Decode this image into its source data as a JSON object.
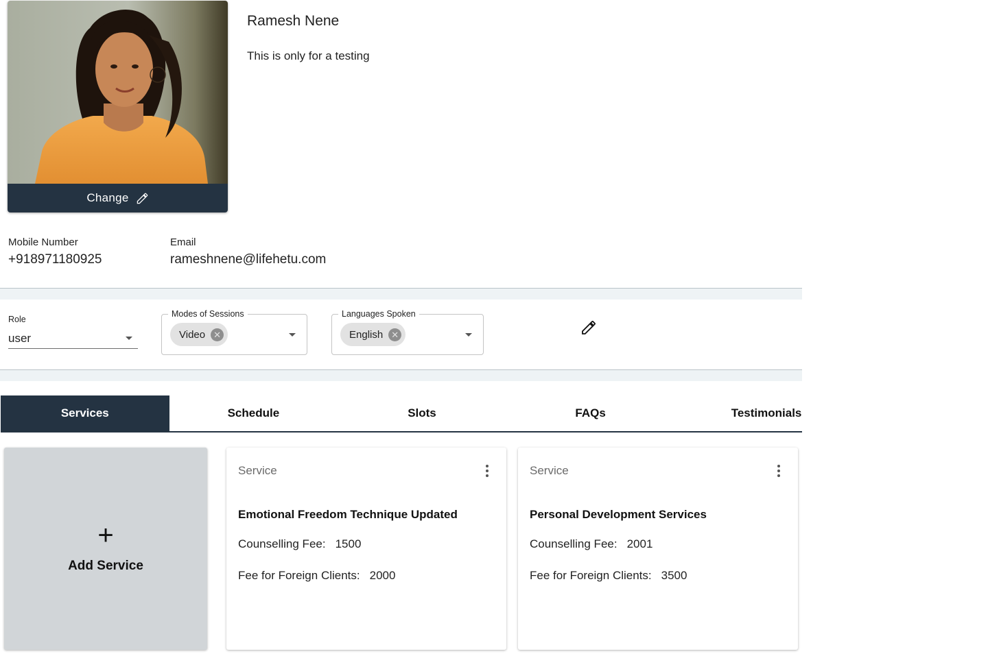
{
  "profile": {
    "name": "Ramesh Nene",
    "bio": "This is only for a testing",
    "change_label": "Change"
  },
  "contact": {
    "mobile_label": "Mobile Number",
    "mobile_value": "+918971180925",
    "email_label": "Email",
    "email_value": "rameshnene@lifehetu.com"
  },
  "settings": {
    "role_label": "Role",
    "role_value": "user",
    "modes_label": "Modes of Sessions",
    "modes_chip": "Video",
    "languages_label": "Languages Spoken",
    "languages_chip": "English"
  },
  "tabs": [
    {
      "label": "Services",
      "active": true
    },
    {
      "label": "Schedule",
      "active": false
    },
    {
      "label": "Slots",
      "active": false
    },
    {
      "label": "FAQs",
      "active": false
    },
    {
      "label": "Testimonials",
      "active": false
    }
  ],
  "services": {
    "add_plus": "+",
    "add_label": "Add Service",
    "cards": [
      {
        "overline": "Service",
        "title": "Emotional Freedom Technique Updated",
        "fee_label": "Counselling Fee:",
        "fee_value": "1500",
        "foreign_label": "Fee for Foreign Clients:",
        "foreign_value": "2000"
      },
      {
        "overline": "Service",
        "title": "Personal Development Services",
        "fee_label": "Counselling Fee:",
        "fee_value": "2001",
        "foreign_label": "Fee for Foreign Clients:",
        "foreign_value": "3500"
      }
    ]
  },
  "colors": {
    "primary_dark": "#243342",
    "card_add_bg": "#d1d5d8",
    "band_bg": "#eef3f5",
    "chip_bg": "#e2e2e2"
  },
  "icons": {
    "change": "pencil-icon",
    "edit_settings": "pencil-icon",
    "card_menu": "more-vert-icon",
    "select_caret": "arrow-drop-down-icon",
    "chip_remove": "cancel-circle-icon"
  }
}
